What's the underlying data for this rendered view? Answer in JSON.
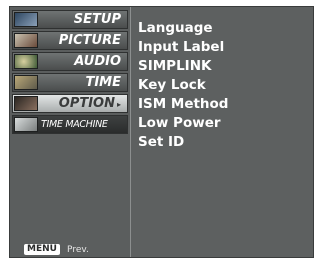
{
  "menu": {
    "tabs": [
      {
        "label": "SETUP",
        "icon": "setup-icon",
        "thumb_color": "#4a6a8a"
      },
      {
        "label": "PICTURE",
        "icon": "picture-icon",
        "thumb_color": "#8a5a4a"
      },
      {
        "label": "AUDIO",
        "icon": "audio-icon",
        "thumb_color": "#5a7a4a"
      },
      {
        "label": "TIME",
        "icon": "time-icon",
        "thumb_color": "#9a8a5a"
      },
      {
        "label": "OPTION",
        "icon": "option-icon",
        "thumb_color": "#6a5a4a",
        "selected": true,
        "caret": "▸"
      },
      {
        "label": "TIME MACHINE",
        "icon": "time-machine-icon",
        "thumb_color": "#a0a4a4"
      }
    ],
    "option_items": [
      "Language",
      "Input Label",
      "SIMPLINK",
      "Key Lock",
      "ISM Method",
      "Low Power",
      "Set ID"
    ],
    "footer": {
      "key": "MENU",
      "label": "Prev."
    }
  },
  "colors": {
    "panel_bg": "#5d6060",
    "selected_tab": "#d4d7d7",
    "text": "#ffffff"
  }
}
